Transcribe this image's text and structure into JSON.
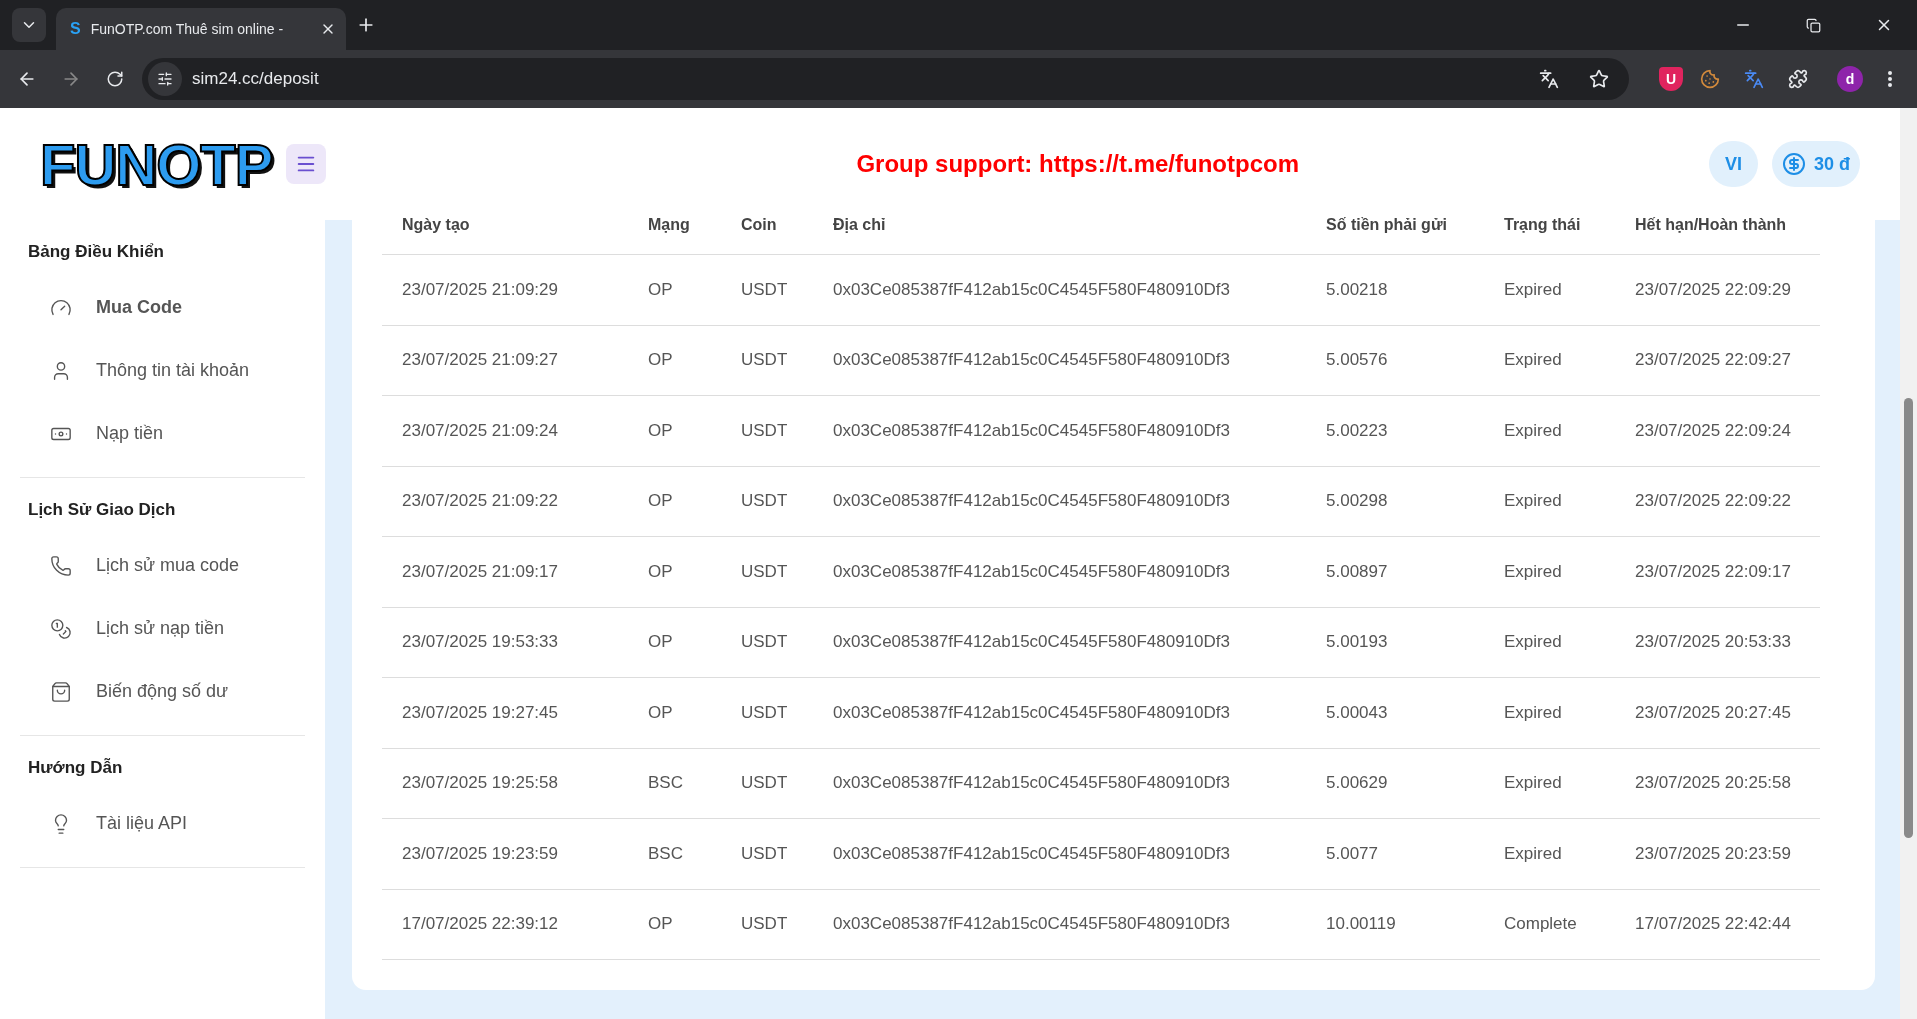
{
  "browser": {
    "favicon_letter": "S",
    "tab_title": "FunOTP.com Thuê sim online -",
    "url": "sim24.cc/deposit",
    "shield_letter": "U",
    "profile_letter": "d"
  },
  "header": {
    "logo": "FUNOTP",
    "support_text": "Group support: https://t.me/funotpcom",
    "language": "VI",
    "balance": "30 đ"
  },
  "sidebar": {
    "sections": [
      {
        "title": "Bảng Điều Khiển",
        "items": [
          {
            "label": "Mua Code",
            "selected": true
          },
          {
            "label": "Thông tin tài khoản",
            "selected": false
          },
          {
            "label": "Nạp tiền",
            "selected": false
          }
        ]
      },
      {
        "title": "Lịch Sử Giao Dịch",
        "items": [
          {
            "label": "Lịch sử mua code",
            "selected": false
          },
          {
            "label": "Lịch sử nạp tiền",
            "selected": false
          },
          {
            "label": "Biến động số dư",
            "selected": false
          }
        ]
      },
      {
        "title": "Hướng Dẫn",
        "items": [
          {
            "label": "Tài liệu API",
            "selected": false
          }
        ]
      }
    ]
  },
  "table": {
    "columns": [
      "Ngày tạo",
      "Mạng",
      "Coin",
      "Địa chỉ",
      "Số tiền phải gửi",
      "Trạng thái",
      "Hết hạn/Hoàn thành"
    ],
    "rows": [
      [
        "23/07/2025 21:09:29",
        "OP",
        "USDT",
        "0x03Ce085387fF412ab15c0C4545F580F480910Df3",
        "5.00218",
        "Expired",
        "23/07/2025 22:09:29"
      ],
      [
        "23/07/2025 21:09:27",
        "OP",
        "USDT",
        "0x03Ce085387fF412ab15c0C4545F580F480910Df3",
        "5.00576",
        "Expired",
        "23/07/2025 22:09:27"
      ],
      [
        "23/07/2025 21:09:24",
        "OP",
        "USDT",
        "0x03Ce085387fF412ab15c0C4545F580F480910Df3",
        "5.00223",
        "Expired",
        "23/07/2025 22:09:24"
      ],
      [
        "23/07/2025 21:09:22",
        "OP",
        "USDT",
        "0x03Ce085387fF412ab15c0C4545F580F480910Df3",
        "5.00298",
        "Expired",
        "23/07/2025 22:09:22"
      ],
      [
        "23/07/2025 21:09:17",
        "OP",
        "USDT",
        "0x03Ce085387fF412ab15c0C4545F580F480910Df3",
        "5.00897",
        "Expired",
        "23/07/2025 22:09:17"
      ],
      [
        "23/07/2025 19:53:33",
        "OP",
        "USDT",
        "0x03Ce085387fF412ab15c0C4545F580F480910Df3",
        "5.00193",
        "Expired",
        "23/07/2025 20:53:33"
      ],
      [
        "23/07/2025 19:27:45",
        "OP",
        "USDT",
        "0x03Ce085387fF412ab15c0C4545F580F480910Df3",
        "5.00043",
        "Expired",
        "23/07/2025 20:27:45"
      ],
      [
        "23/07/2025 19:25:58",
        "BSC",
        "USDT",
        "0x03Ce085387fF412ab15c0C4545F580F480910Df3",
        "5.00629",
        "Expired",
        "23/07/2025 20:25:58"
      ],
      [
        "23/07/2025 19:23:59",
        "BSC",
        "USDT",
        "0x03Ce085387fF412ab15c0C4545F580F480910Df3",
        "5.0077",
        "Expired",
        "23/07/2025 20:23:59"
      ],
      [
        "17/07/2025 22:39:12",
        "OP",
        "USDT",
        "0x03Ce085387fF412ab15c0C4545F580F480910Df3",
        "10.00119",
        "Complete",
        "17/07/2025 22:42:44"
      ]
    ]
  }
}
